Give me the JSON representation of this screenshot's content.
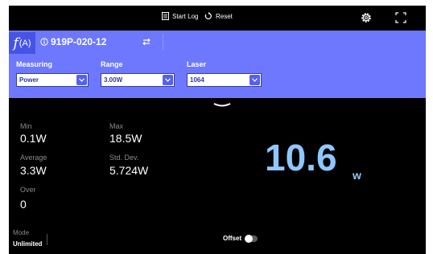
{
  "toolbar": {
    "start_log": "Start Log",
    "reset": "Reset"
  },
  "header": {
    "function_glyph": "f",
    "function_sub": "(A)",
    "sensor_id": "919P-020-12"
  },
  "fields": {
    "measuring": {
      "label": "Measuring",
      "value": "Power"
    },
    "range": {
      "label": "Range",
      "value": "3.00W"
    },
    "laser": {
      "label": "Laser",
      "value": "1064"
    }
  },
  "stats": {
    "min_label": "Min",
    "min_value": "0.1W",
    "max_label": "Max",
    "max_value": "18.5W",
    "avg_label": "Average",
    "avg_value": "3.3W",
    "std_label": "Std. Dev.",
    "std_value": "5.724W",
    "over_label": "Over",
    "over_value": "0"
  },
  "reading": {
    "value": "10.6",
    "unit": "w"
  },
  "footer": {
    "mode_label": "Mode",
    "mode_value": "Unlimited",
    "offset_label": "Offset",
    "offset_on": false
  },
  "colors": {
    "header_bg": "#6d78ff",
    "reading": "#8ec7ff",
    "background": "#000000"
  },
  "icons": [
    "log-icon",
    "reset-icon",
    "gear-icon",
    "fullscreen-icon",
    "info-icon",
    "swap-icon",
    "chevron-down-icon"
  ]
}
